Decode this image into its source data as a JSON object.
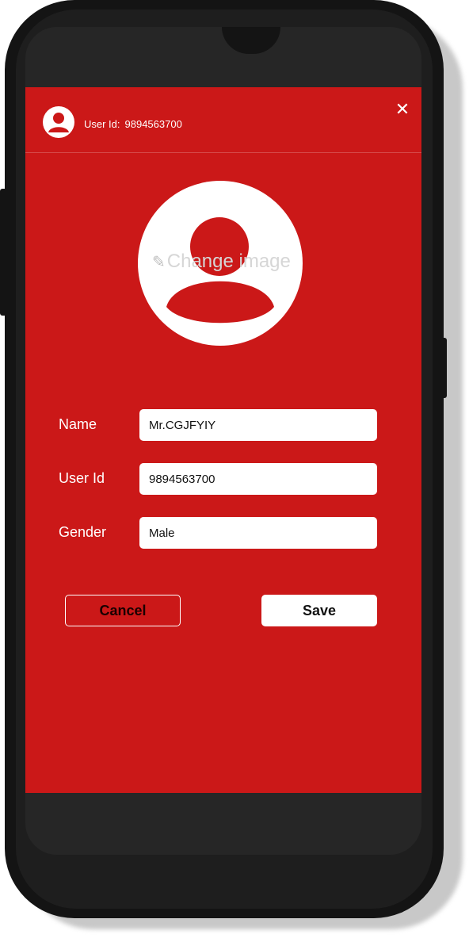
{
  "header": {
    "user_id_label": "User Id:",
    "user_id_value": "9894563700",
    "close_icon": "close-icon"
  },
  "profile_image": {
    "change_label": "Change image",
    "edit_icon": "pencil-icon"
  },
  "form": {
    "name": {
      "label": "Name",
      "value": "Mr.CGJFYIY"
    },
    "user_id": {
      "label": "User Id",
      "value": "9894563700"
    },
    "gender": {
      "label": "Gender",
      "value": "Male"
    }
  },
  "actions": {
    "cancel_label": "Cancel",
    "save_label": "Save"
  },
  "colors": {
    "app_background": "#cb1818",
    "phone_frame": "#141414"
  }
}
